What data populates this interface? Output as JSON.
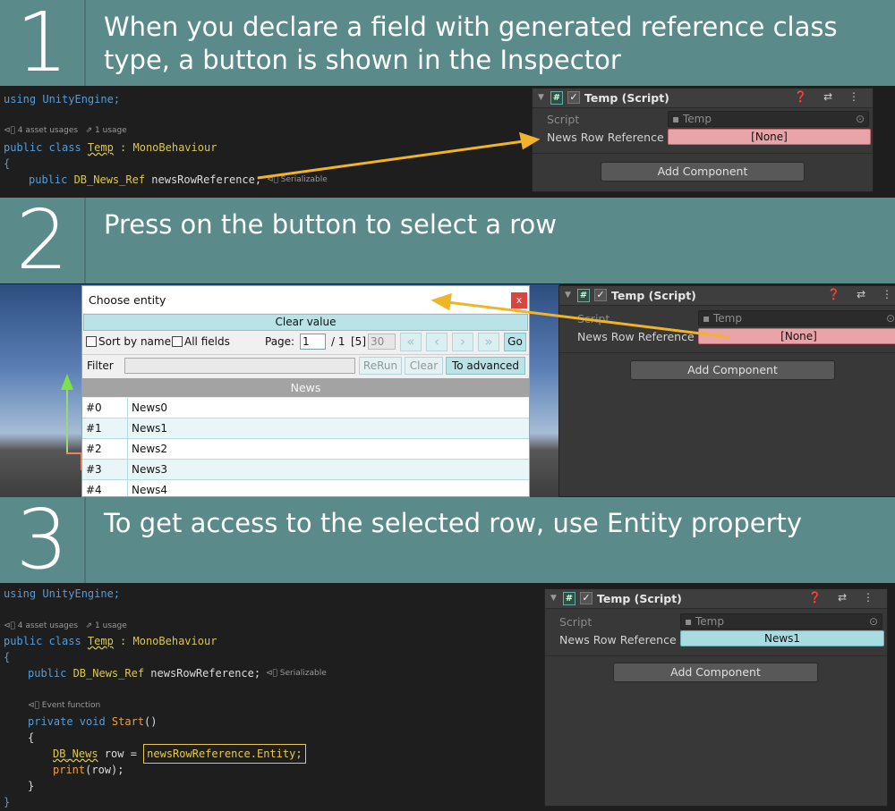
{
  "step1": {
    "number": "1",
    "text": "When you declare a field with generated reference class type, a  button is shown in the Inspector",
    "code": {
      "using": "using UnityEngine;",
      "usages": "⊲⃝ 4 asset usages   ⇗ 1 usage",
      "class_prefix": "public class ",
      "class_name": "Temp",
      "class_suffix": " : MonoBehaviour",
      "brace": "{",
      "field_prefix": "public ",
      "field_type": "DB_News_Ref",
      "field_rest": " newsRowReference;",
      "serializable": "⊲⃝ Serializable"
    },
    "inspector": {
      "title": "Temp (Script)",
      "script_label": "Script",
      "script_value": "Temp",
      "field_label": "News Row Reference",
      "field_value": "[None]",
      "add_component": "Add Component"
    }
  },
  "step2": {
    "number": "2",
    "text": "Press on the button to select a row",
    "dialog": {
      "title": "Choose entity",
      "close": "x",
      "clear_value": "Clear value",
      "sort_by_name": "Sort by name",
      "all_fields": "All fields",
      "page_label": "Page:",
      "page_value": "1",
      "page_total": "/ 1",
      "count": "[5]",
      "page_size": "30",
      "nav_first": "«",
      "nav_prev": "‹",
      "nav_next": "›",
      "nav_last": "»",
      "go": "Go",
      "filter_label": "Filter",
      "rerun": "ReRun",
      "clear": "Clear",
      "to_advanced": "To advanced",
      "column": "News",
      "rows": [
        {
          "id": "#0",
          "name": "News0"
        },
        {
          "id": "#1",
          "name": "News1"
        },
        {
          "id": "#2",
          "name": "News2"
        },
        {
          "id": "#3",
          "name": "News3"
        },
        {
          "id": "#4",
          "name": "News4"
        }
      ]
    },
    "inspector": {
      "title": "Temp (Script)",
      "script_label": "Script",
      "script_value": "Temp",
      "field_label": "News Row Reference",
      "field_value": "[None]",
      "add_component": "Add Component"
    }
  },
  "step3": {
    "number": "3",
    "text": "To get access to the selected row, use Entity property",
    "code": {
      "using": "using UnityEngine;",
      "usages": "⊲⃝ 4 asset usages   ⇗ 1 usage",
      "class_prefix": "public class ",
      "class_name": "Temp",
      "class_suffix": " : MonoBehaviour",
      "brace_open": "{",
      "field_prefix": "public ",
      "field_type": "DB_News_Ref",
      "field_rest": " newsRowReference;",
      "serializable": "⊲⃝ Serializable",
      "event_fn": "⊲⃝ Event function",
      "method_prefix": "private void ",
      "method_name": "Start",
      "method_suffix": "()",
      "inner_open": "{",
      "row_type": "DB_News",
      "row_decl": " row = ",
      "row_expr": "newsRowReference.Entity;",
      "print_fn": "print",
      "print_args": "(row);",
      "inner_close": "}",
      "brace_close": "}"
    },
    "inspector": {
      "title": "Temp (Script)",
      "script_label": "Script",
      "script_value": "Temp",
      "field_label": "News Row Reference",
      "field_value": "News1",
      "add_component": "Add Component"
    }
  },
  "icons": {
    "collapse": "▼",
    "script_badge": "#",
    "checkbox": "✓",
    "header_icons": "❓ ⇄ ⋮",
    "file": "▪",
    "target": "⊙"
  },
  "colors": {
    "banner": "#5b8a8b",
    "none_field": "#e8a4a8",
    "set_field": "#a8dce0",
    "arrow": "#f0b429"
  }
}
